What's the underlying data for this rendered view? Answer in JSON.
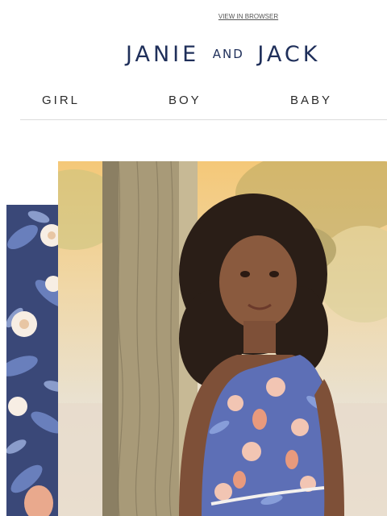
{
  "header": {
    "view_in_browser": "VIEW IN BROWSER",
    "brand_name_part1": "JANIE",
    "brand_and": "AND",
    "brand_name_part2": "JACK"
  },
  "nav": {
    "items": [
      {
        "label": "GIRL"
      },
      {
        "label": "BOY"
      },
      {
        "label": "BABY"
      }
    ]
  },
  "colors": {
    "brand_navy": "#1f2f5a",
    "pattern_navy": "#3a4878",
    "divider": "#dcdcdc"
  }
}
